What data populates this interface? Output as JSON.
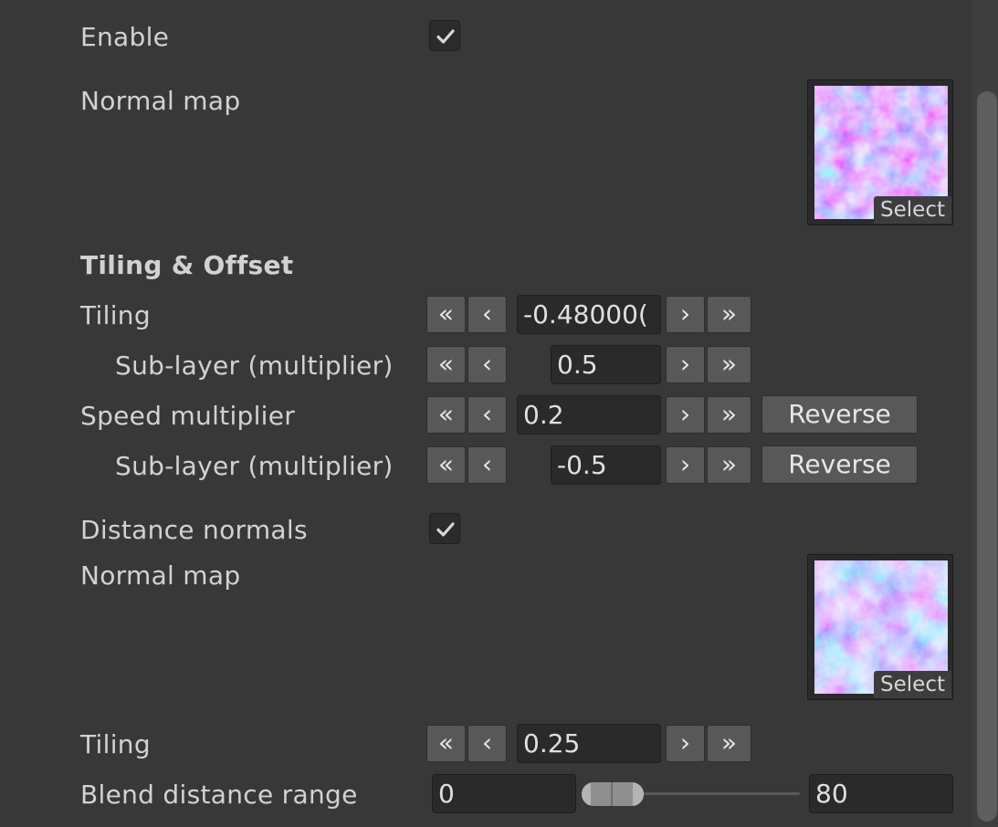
{
  "enable": {
    "label": "Enable",
    "checked": true
  },
  "normal_map_1": {
    "label": "Normal map",
    "select_label": "Select"
  },
  "section_tiling_offset": {
    "title": "Tiling & Offset"
  },
  "tiling": {
    "label": "Tiling",
    "value": "-0.48000("
  },
  "tiling_sub": {
    "label": "Sub-layer (multiplier)",
    "value": "0.5"
  },
  "speed": {
    "label": "Speed multiplier",
    "value": "0.2",
    "reverse_label": "Reverse"
  },
  "speed_sub": {
    "label": "Sub-layer (multiplier)",
    "value": "-0.5",
    "reverse_label": "Reverse"
  },
  "distance_normals": {
    "label": "Distance normals",
    "checked": true
  },
  "normal_map_2": {
    "label": "Normal map",
    "select_label": "Select"
  },
  "tiling_2": {
    "label": "Tiling",
    "value": "0.25"
  },
  "blend": {
    "label": "Blend distance range",
    "min_value": "0",
    "max_value": "80"
  },
  "stepper": {
    "fast_dec": "«",
    "dec": "‹",
    "inc": "›",
    "fast_inc": "»"
  }
}
